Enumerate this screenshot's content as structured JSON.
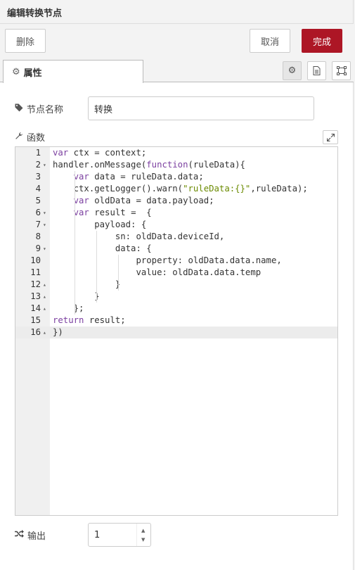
{
  "header": {
    "title": "编辑转换节点"
  },
  "toolbar": {
    "delete_label": "删除",
    "cancel_label": "取消",
    "done_label": "完成",
    "done_color": "#ad1625"
  },
  "tabs": {
    "properties_label": "属性"
  },
  "form": {
    "name_label": "节点名称",
    "name_value": "转换",
    "function_label": "函数",
    "outputs_label": "输出",
    "outputs_value": "1"
  },
  "editor": {
    "lines": [
      {
        "n": "1",
        "fold": "",
        "text": "var ctx = context;"
      },
      {
        "n": "2",
        "fold": "▾",
        "text": "handler.onMessage(function(ruleData){"
      },
      {
        "n": "3",
        "fold": "",
        "text": "    var data = ruleData.data;"
      },
      {
        "n": "4",
        "fold": "",
        "text": "    ctx.getLogger().warn(\"ruleData:{}\",ruleData);"
      },
      {
        "n": "5",
        "fold": "",
        "text": "    var oldData = data.payload;"
      },
      {
        "n": "6",
        "fold": "▾",
        "text": "    var result =  {"
      },
      {
        "n": "7",
        "fold": "▾",
        "text": "        payload: {"
      },
      {
        "n": "8",
        "fold": "",
        "text": "            sn: oldData.deviceId,"
      },
      {
        "n": "9",
        "fold": "▾",
        "text": "            data: {"
      },
      {
        "n": "10",
        "fold": "",
        "text": "                property: oldData.data.name,"
      },
      {
        "n": "11",
        "fold": "",
        "text": "                value: oldData.data.temp"
      },
      {
        "n": "12",
        "fold": "▴",
        "text": "            }"
      },
      {
        "n": "13",
        "fold": "▴",
        "text": "        }"
      },
      {
        "n": "14",
        "fold": "▴",
        "text": "    };"
      },
      {
        "n": "15",
        "fold": "",
        "text": "return result;"
      },
      {
        "n": "16",
        "fold": "▴",
        "text": "})"
      }
    ],
    "active_line": 16
  }
}
